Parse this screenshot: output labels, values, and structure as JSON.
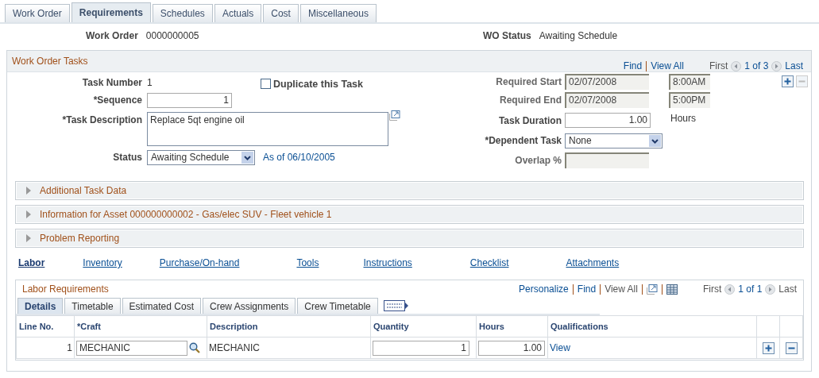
{
  "tabs": [
    {
      "label": "Work Order",
      "selected": false
    },
    {
      "label": "Requirements",
      "selected": true
    },
    {
      "label": "Schedules",
      "selected": false
    },
    {
      "label": "Actuals",
      "selected": false
    },
    {
      "label": "Cost",
      "selected": false
    },
    {
      "label": "Miscellaneous",
      "selected": false
    }
  ],
  "header": [
    {
      "label": "Work Order",
      "value": "0000000005"
    },
    {
      "label": "WO Status",
      "value": "Awaiting Schedule"
    }
  ],
  "tasks": {
    "title": "Work Order Tasks",
    "find": "Find",
    "view_all": "View All",
    "first": "First",
    "count": "1 of 3",
    "last": "Last",
    "task_number": {
      "label": "Task Number",
      "value": "1"
    },
    "duplicate": {
      "label": "Duplicate this Task",
      "checked": false
    },
    "sequence": {
      "label": "*Sequence",
      "value": "1"
    },
    "description": {
      "label": "*Task Description",
      "value": "Replace 5qt engine oil"
    },
    "status": {
      "label": "Status",
      "value": "Awaiting Schedule",
      "as_of": "As of 06/10/2005"
    },
    "right_fields": [
      {
        "label": "Required Start",
        "value": "02/07/2008",
        "kind": "input",
        "disabled": true,
        "time": "8:00AM"
      },
      {
        "label": "Required End",
        "value": "02/07/2008",
        "kind": "input",
        "disabled": true,
        "time": "5:00PM"
      },
      {
        "label": "Task Duration",
        "value": "1.00",
        "kind": "input",
        "disabled": false,
        "unit": "Hours"
      },
      {
        "label": "*Dependent Task",
        "value": "None",
        "kind": "select",
        "disabled": false
      },
      {
        "label": "Overlap %",
        "kind": "input",
        "disabled": true
      }
    ],
    "remove_disabled": true
  },
  "sections": [
    {
      "label": "Additional Task Data",
      "expanded": false
    },
    {
      "label": "Information for Asset 000000000002 - Gas/elec SUV - Fleet vehicle 1",
      "expanded": false
    },
    {
      "label": "Problem Reporting",
      "expanded": false
    }
  ],
  "links": [
    {
      "label": "Labor",
      "selected": true
    },
    {
      "label": "Inventory",
      "selected": false
    },
    {
      "label": "Purchase/On-hand",
      "selected": false
    },
    {
      "label": "Tools",
      "selected": false
    },
    {
      "label": "Instructions",
      "selected": false
    },
    {
      "label": "Checklist",
      "selected": false
    },
    {
      "label": "Attachments",
      "selected": false
    }
  ],
  "labor": {
    "title": "Labor Requirements",
    "personalize": "Personalize",
    "find": "Find",
    "view_all": "View All",
    "first": "First",
    "count": "1 of 1",
    "last": "Last",
    "tabs": [
      {
        "label": "Details",
        "selected": true
      },
      {
        "label": "Timetable",
        "selected": false
      },
      {
        "label": "Estimated Cost",
        "selected": false
      },
      {
        "label": "Crew Assignments",
        "selected": false
      },
      {
        "label": "Crew Timetable",
        "selected": false
      }
    ],
    "columns": [
      "Line No.",
      "*Craft",
      "Description",
      "Quantity",
      "Hours",
      "Qualifications"
    ],
    "rows": [
      {
        "line": "1",
        "craft": "MECHANIC",
        "description": "MECHANIC",
        "quantity": "1",
        "hours": "1.00",
        "qualifications": "View"
      }
    ]
  }
}
